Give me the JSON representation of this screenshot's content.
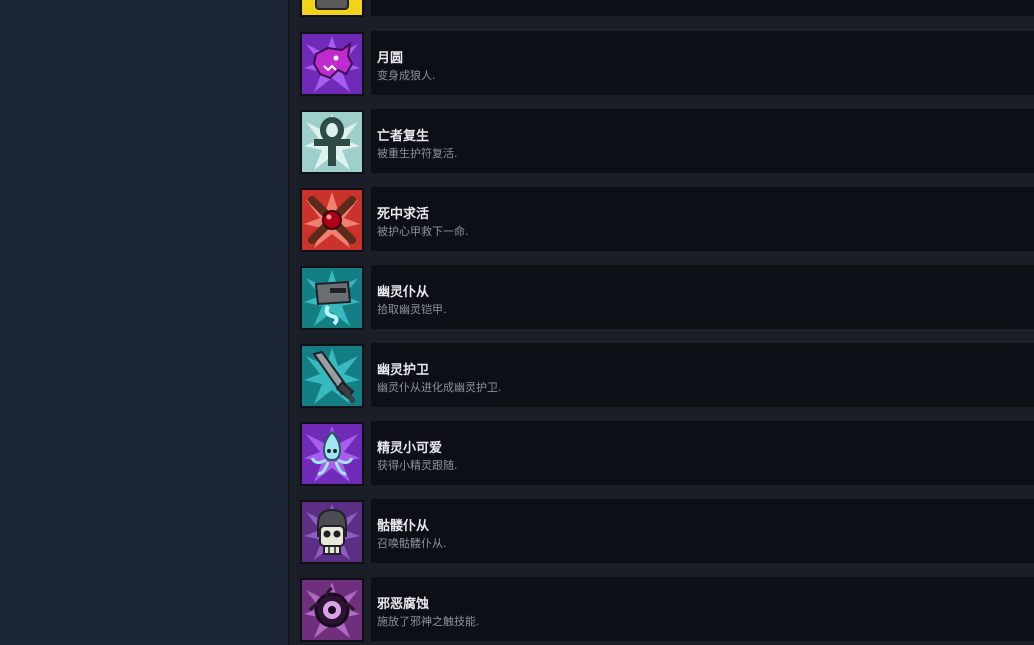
{
  "achievements": [
    {
      "title": "",
      "description": "",
      "icon": "yellow-badge-icon",
      "color": "#f2d21a"
    },
    {
      "title": "月圆",
      "description": "变身成狼人.",
      "icon": "werewolf-icon",
      "color": "#8f3cd8"
    },
    {
      "title": "亡者复生",
      "description": "被重生护符复活.",
      "icon": "ankh-icon",
      "color": "#bfe0de"
    },
    {
      "title": "死中求活",
      "description": "被护心甲救下一命.",
      "icon": "heart-crossbones-icon",
      "color": "#d9473b"
    },
    {
      "title": "幽灵仆从",
      "description": "拾取幽灵铠甲.",
      "icon": "ghost-helmet-icon",
      "color": "#1f9fa3"
    },
    {
      "title": "幽灵护卫",
      "description": "幽灵仆从进化成幽灵护卫.",
      "icon": "ghost-sword-icon",
      "color": "#1f9fa3"
    },
    {
      "title": "精灵小可爱",
      "description": "获得小精灵跟随.",
      "icon": "wisp-icon",
      "color": "#8f3cd8"
    },
    {
      "title": "骷髅仆从",
      "description": "召唤骷髅仆从.",
      "icon": "skull-icon",
      "color": "#7b3fae"
    },
    {
      "title": "邪恶腐蚀",
      "description": "施放了邪神之触技能.",
      "icon": "evil-eye-icon",
      "color": "#9a3ea6"
    }
  ]
}
